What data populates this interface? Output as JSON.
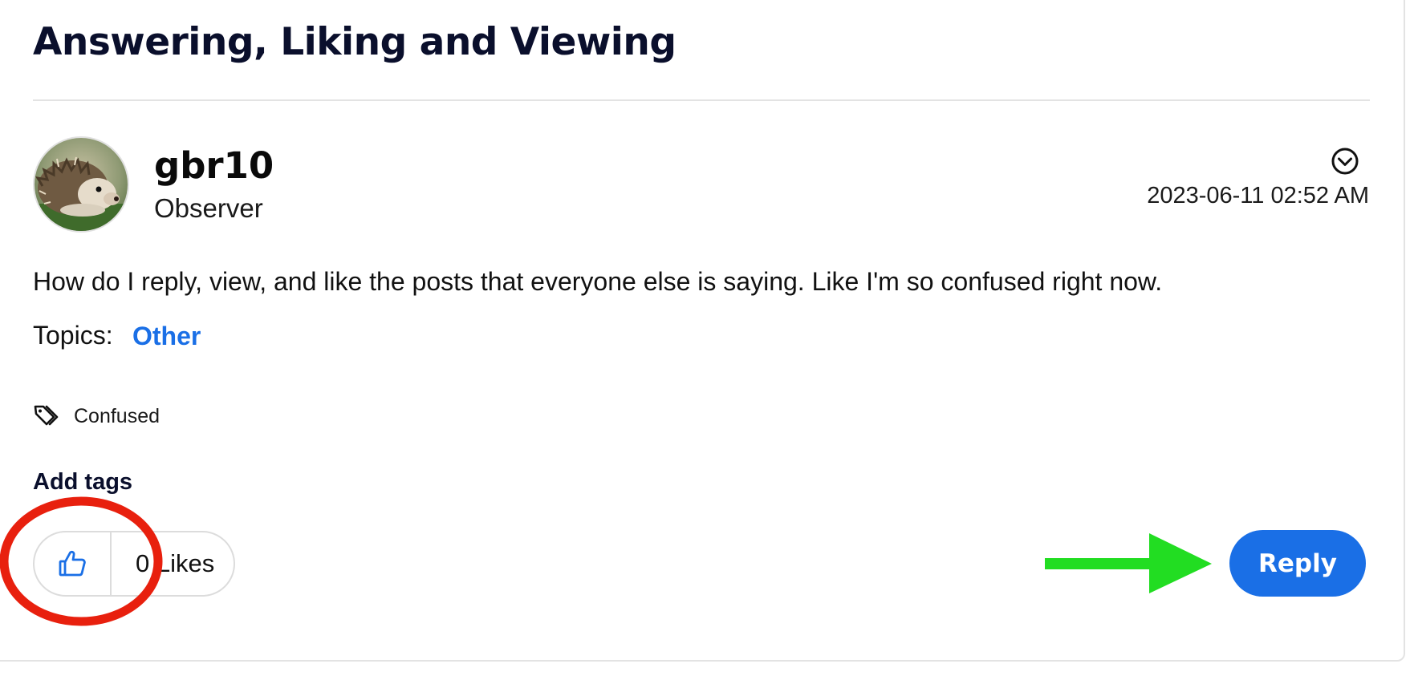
{
  "thread": {
    "title": "Answering, Liking and Viewing"
  },
  "post": {
    "author": {
      "username": "gbr10",
      "rank": "Observer",
      "avatar_icon": "hedgehog-avatar"
    },
    "timestamp": "2023-06-11 02:52 AM",
    "options_icon": "chevron-circle-down-icon",
    "body": "How do I reply, view, and like the posts that everyone else is saying. Like I'm so confused right now.",
    "topics": {
      "label": "Topics:",
      "items": [
        "Other"
      ]
    },
    "tags": {
      "icon": "tags-icon",
      "items": [
        "Confused"
      ],
      "add_label": "Add tags"
    },
    "kudos": {
      "icon": "thumbs-up-icon",
      "count_text": "0 Likes"
    },
    "reply_label": "Reply"
  },
  "annotations": {
    "circle_color": "#e8200e",
    "arrow_color": "#22dd22"
  },
  "colors": {
    "accent": "#1a6fe6",
    "title": "#0a0f2c",
    "border": "#e3e3e3"
  }
}
